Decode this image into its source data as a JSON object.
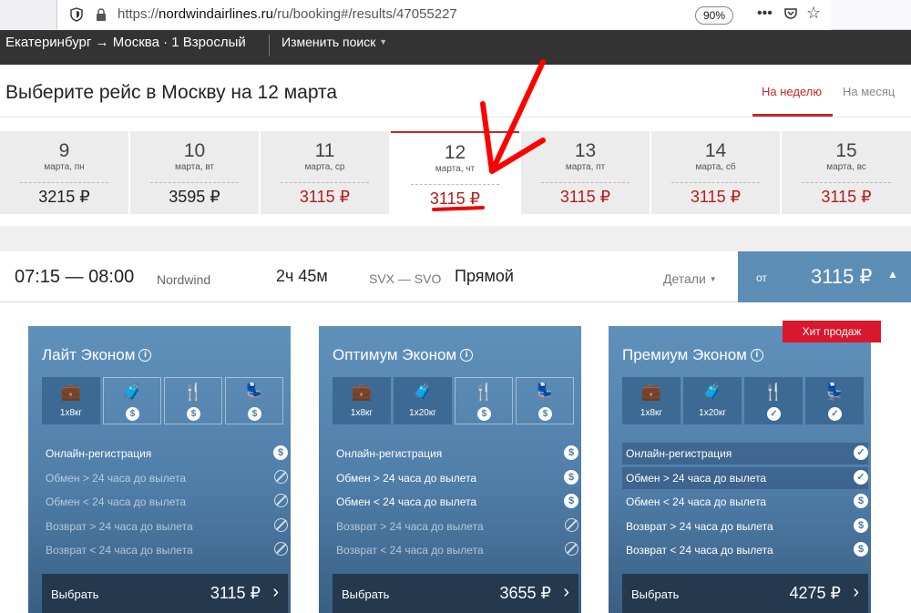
{
  "browser": {
    "url_scheme": "https://",
    "url_host": "nordwindairlines.ru",
    "url_path": "/ru/booking#/results/47055227",
    "zoom": "90%"
  },
  "header": {
    "route_from": "Екатеринбург",
    "route_arrow": "→",
    "route_to": "Москва",
    "passengers": "· 1 Взрослый",
    "change_search": "Изменить поиск"
  },
  "page": {
    "title": "Выберите рейс в Москву на 12 марта",
    "tab_week": "На неделю",
    "tab_month": "На месяц"
  },
  "dates": [
    {
      "day": "9",
      "dow": "марта, пн",
      "price": "3215 ₽",
      "cheapest": false,
      "active": false
    },
    {
      "day": "10",
      "dow": "марта, вт",
      "price": "3595 ₽",
      "cheapest": false,
      "active": false
    },
    {
      "day": "11",
      "dow": "марта, ср",
      "price": "3115 ₽",
      "cheapest": true,
      "active": false
    },
    {
      "day": "12",
      "dow": "марта, чт",
      "price": "3115 ₽",
      "cheapest": true,
      "active": true
    },
    {
      "day": "13",
      "dow": "марта, пт",
      "price": "3115 ₽",
      "cheapest": true,
      "active": false
    },
    {
      "day": "14",
      "dow": "марта, сб",
      "price": "3115 ₽",
      "cheapest": true,
      "active": false
    },
    {
      "day": "15",
      "dow": "марта, вс",
      "price": "3115 ₽",
      "cheapest": true,
      "active": false
    }
  ],
  "flight": {
    "time": "07:15 — 08:00",
    "airline": "Nordwind",
    "duration": "2ч 45м",
    "route": "SVX — SVO",
    "type": "Прямой",
    "details": "Детали",
    "from_label": "от",
    "price": "3115 ₽"
  },
  "fares": [
    {
      "title": "Лайт Эконом",
      "bag_hand": "1x8кг",
      "bag_checked": "",
      "features": [
        {
          "text": "Онлайн-регистрация",
          "status": "paid"
        },
        {
          "text": "Обмен > 24 часа до вылета",
          "status": "no"
        },
        {
          "text": "Обмен < 24 часа до вылета",
          "status": "no"
        },
        {
          "text": "Возврат > 24 часа до вылета",
          "status": "no"
        },
        {
          "text": "Возврат < 24 часа до вылета",
          "status": "no"
        }
      ],
      "select_label": "Выбрать",
      "price": "3115 ₽"
    },
    {
      "title": "Оптимум Эконом",
      "bag_hand": "1x8кг",
      "bag_checked": "1x20кг",
      "features": [
        {
          "text": "Онлайн-регистрация",
          "status": "paid"
        },
        {
          "text": "Обмен > 24 часа до вылета",
          "status": "paid"
        },
        {
          "text": "Обмен < 24 часа до вылета",
          "status": "paid"
        },
        {
          "text": "Возврат > 24 часа до вылета",
          "status": "no"
        },
        {
          "text": "Возврат < 24 часа до вылета",
          "status": "no"
        }
      ],
      "select_label": "Выбрать",
      "price": "3655 ₽"
    },
    {
      "title": "Премиум Эконом",
      "bag_hand": "1x8кг",
      "bag_checked": "1x20кг",
      "badge": "Хит продаж",
      "features": [
        {
          "text": "Онлайн-регистрация",
          "status": "included"
        },
        {
          "text": "Обмен > 24 часа до вылета",
          "status": "included"
        },
        {
          "text": "Обмен < 24 часа до вылета",
          "status": "paid"
        },
        {
          "text": "Возврат > 24 часа до вылета",
          "status": "paid"
        },
        {
          "text": "Возврат < 24 часа до вылета",
          "status": "paid"
        }
      ],
      "select_label": "Выбрать",
      "price": "4275 ₽"
    }
  ],
  "colors": {
    "accent_red": "#c62828",
    "price_red": "#b71c1c",
    "card_blue": "#5b8db5",
    "select_dark": "#24384e",
    "header_dark": "#333333"
  }
}
